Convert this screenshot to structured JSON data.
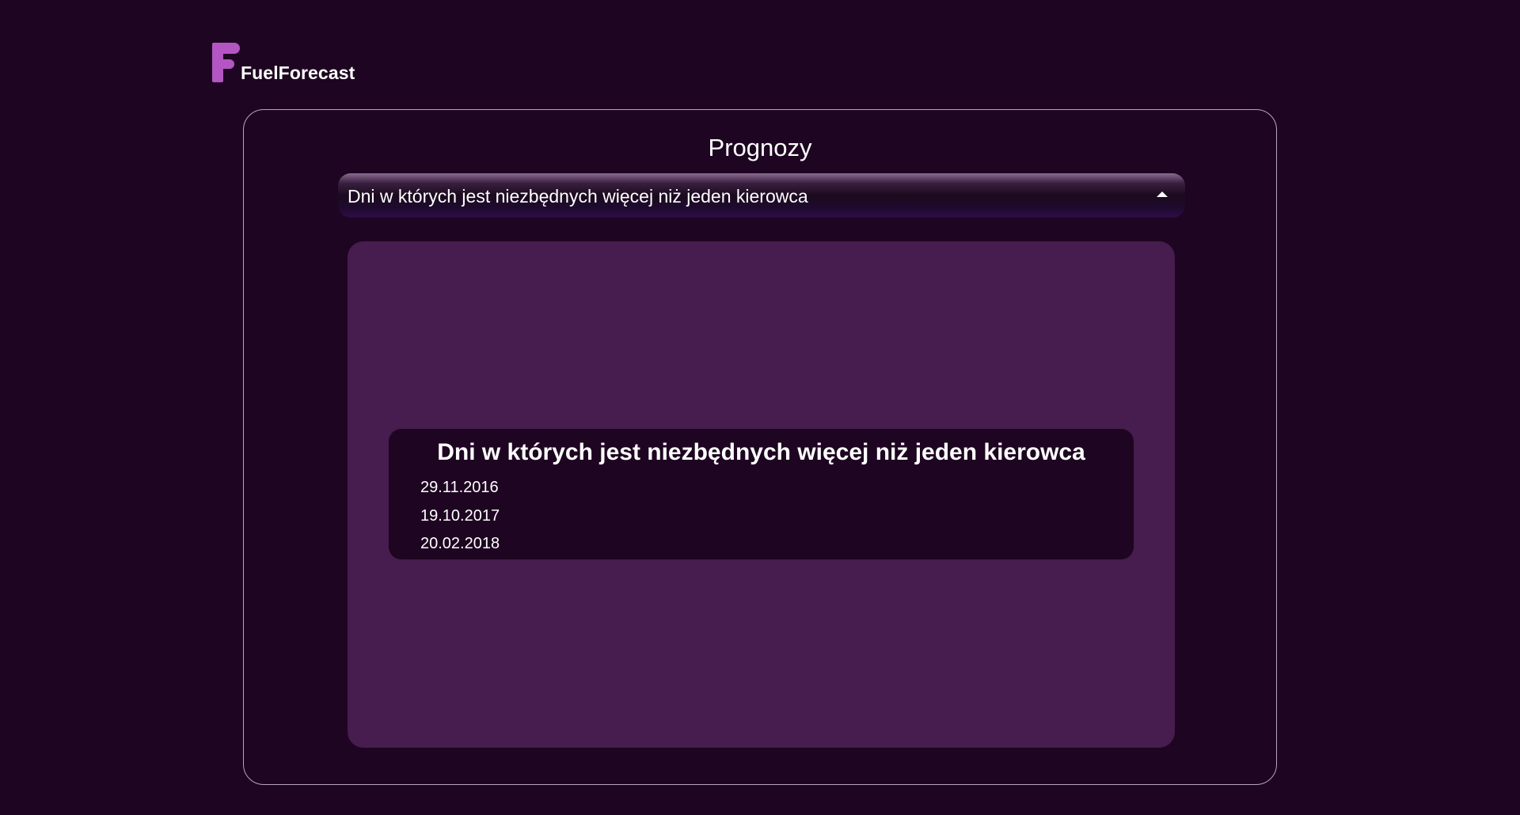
{
  "app": {
    "name": "FuelForecast"
  },
  "page": {
    "title": "Prognozy"
  },
  "forecast_select": {
    "selected": "Dni w których jest niezbędnych więcej niż jeden kierowca"
  },
  "result": {
    "title": "Dni w których jest niezbędnych więcej niż jeden kierowca",
    "dates": [
      "29.11.2016",
      "19.10.2017",
      "20.02.2018"
    ]
  },
  "colors": {
    "background": "#1e0521",
    "accent": "#b455c4",
    "content_area": "#461d4e"
  },
  "icons": {
    "logo": "fuelforecast-logo-icon",
    "select_caret": "caret-up-icon"
  }
}
